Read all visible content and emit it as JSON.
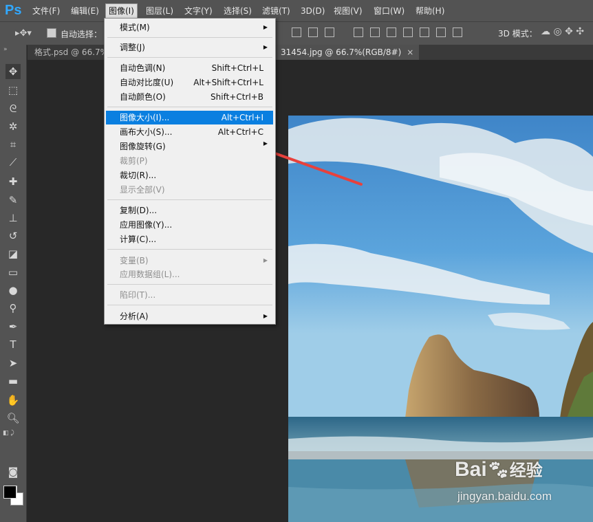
{
  "app": {
    "logo": "Ps"
  },
  "menubar": [
    {
      "label": "文件(F)"
    },
    {
      "label": "编辑(E)"
    },
    {
      "label": "图像(I)"
    },
    {
      "label": "图层(L)"
    },
    {
      "label": "文字(Y)"
    },
    {
      "label": "选择(S)"
    },
    {
      "label": "滤镜(T)"
    },
    {
      "label": "3D(D)"
    },
    {
      "label": "视图(V)"
    },
    {
      "label": "窗口(W)"
    },
    {
      "label": "帮助(H)"
    }
  ],
  "options_bar": {
    "auto_select_label": "自动选择：",
    "mode_3d_label": "3D 模式："
  },
  "tabs": [
    {
      "label": "格式.psd @ 66.7%"
    },
    {
      "label": "31454.jpg @ 66.7%(RGB/8#)",
      "close": "×"
    }
  ],
  "image_menu": {
    "items": [
      {
        "label": "模式(M)",
        "submenu": true
      },
      {
        "label": "调整(J)",
        "submenu": true
      },
      {
        "label": "自动色调(N)",
        "shortcut": "Shift+Ctrl+L"
      },
      {
        "label": "自动对比度(U)",
        "shortcut": "Alt+Shift+Ctrl+L"
      },
      {
        "label": "自动颜色(O)",
        "shortcut": "Shift+Ctrl+B"
      },
      {
        "label": "图像大小(I)...",
        "shortcut": "Alt+Ctrl+I",
        "highlighted": true
      },
      {
        "label": "画布大小(S)...",
        "shortcut": "Alt+Ctrl+C"
      },
      {
        "label": "图像旋转(G)",
        "submenu": true
      },
      {
        "label": "裁剪(P)",
        "disabled": true
      },
      {
        "label": "裁切(R)..."
      },
      {
        "label": "显示全部(V)",
        "disabled": true
      },
      {
        "label": "复制(D)..."
      },
      {
        "label": "应用图像(Y)..."
      },
      {
        "label": "计算(C)..."
      },
      {
        "label": "变量(B)",
        "submenu": true,
        "disabled": true
      },
      {
        "label": "应用数据组(L)...",
        "disabled": true
      },
      {
        "label": "陷印(T)...",
        "disabled": true
      },
      {
        "label": "分析(A)",
        "submenu": true
      }
    ]
  },
  "watermark": {
    "brand": "Bai",
    "brand2": "经验",
    "url": "jingyan.baidu.com"
  },
  "colors": {
    "menu_highlight": "#0a7fe0",
    "ps_blue": "#31a8ff",
    "annotation_arrow": "#e8413c"
  }
}
